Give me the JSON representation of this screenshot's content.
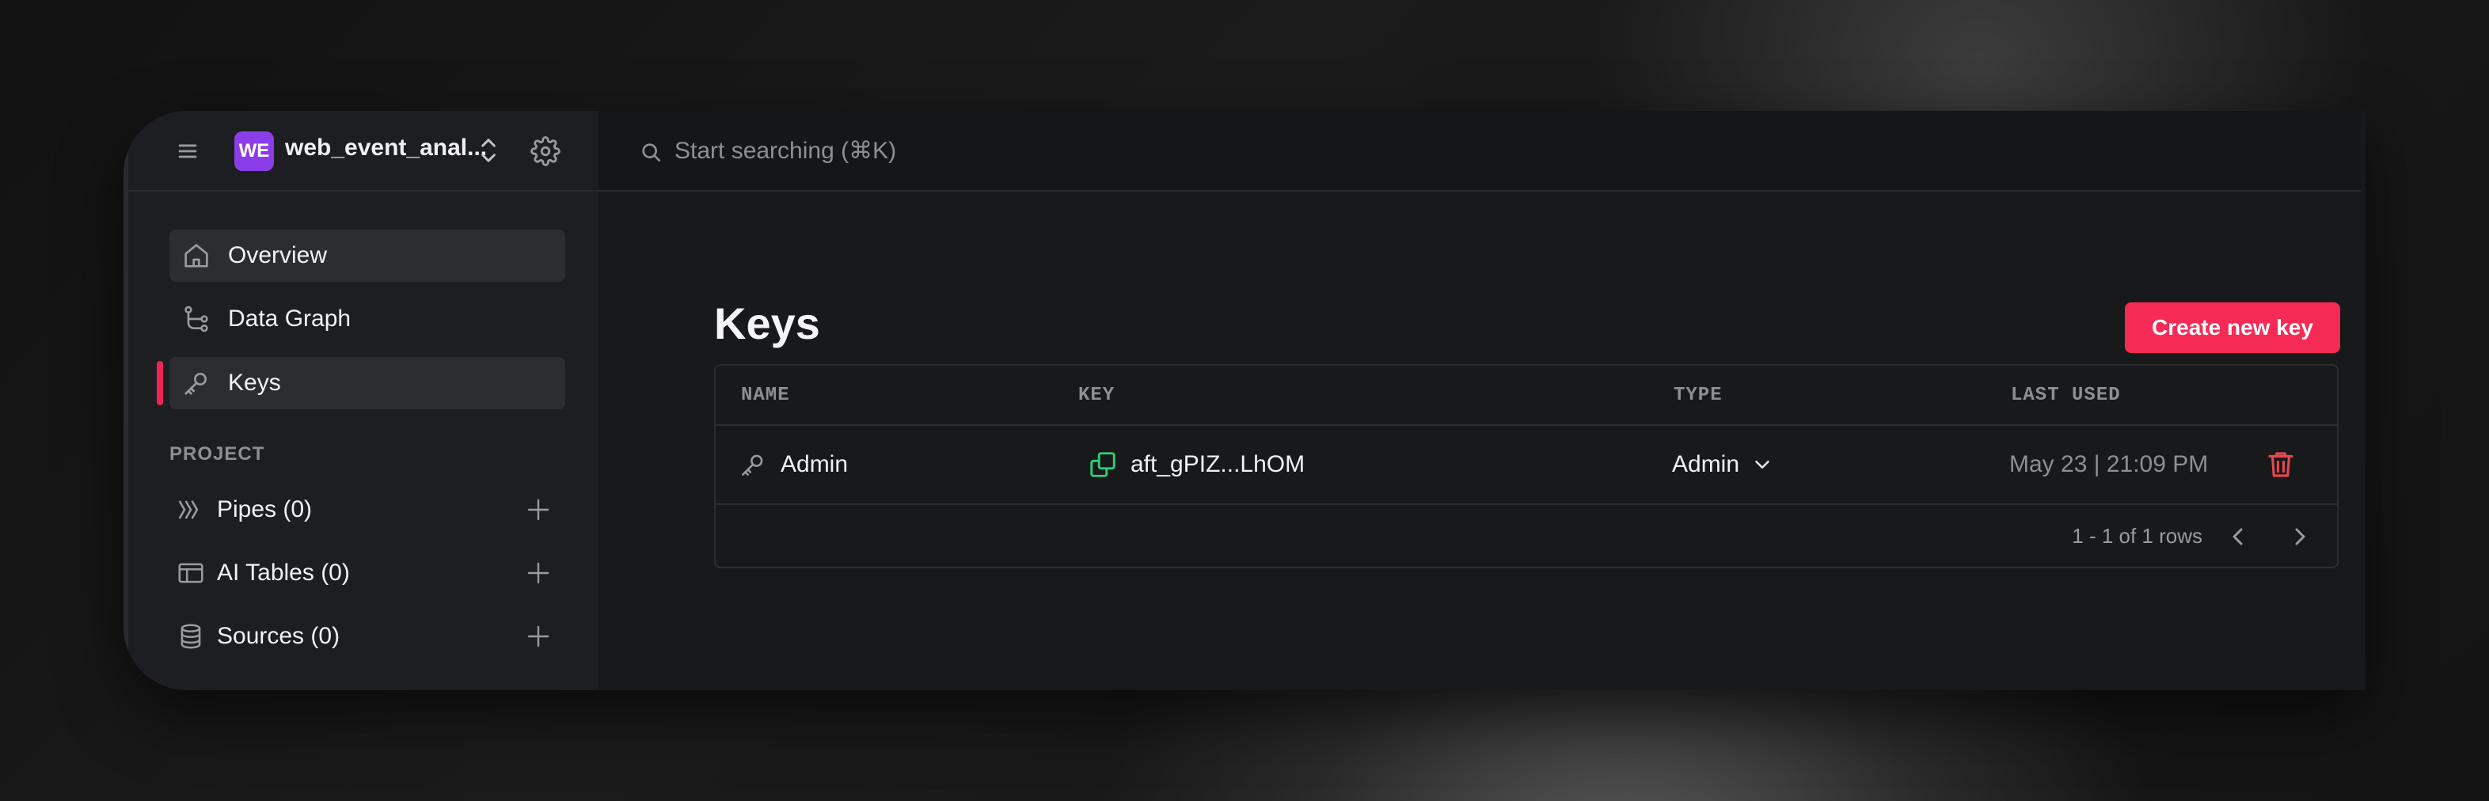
{
  "workspace": {
    "badge": "WE",
    "name": "web_event_anal..."
  },
  "search": {
    "placeholder": "Start searching (⌘K)"
  },
  "nav": {
    "items": [
      {
        "label": "Overview"
      },
      {
        "label": "Data Graph"
      },
      {
        "label": "Keys"
      }
    ]
  },
  "project": {
    "section_label": "PROJECT",
    "items": [
      {
        "label": "Pipes (0)"
      },
      {
        "label": "AI Tables (0)"
      },
      {
        "label": "Sources (0)"
      }
    ]
  },
  "page": {
    "title": "Keys",
    "create_label": "Create new key"
  },
  "table": {
    "columns": [
      "NAME",
      "KEY",
      "TYPE",
      "LAST USED"
    ],
    "rows": [
      {
        "name": "Admin",
        "key": "aft_gPIZ...LhOM",
        "type": "Admin",
        "last_used": "May 23 | 21:09 PM"
      }
    ],
    "pagination": "1 - 1 of 1 rows"
  },
  "colors": {
    "accent": "#f52a55",
    "workspace_badge": "#8b3ee8",
    "copy_icon": "#2fd07a",
    "delete_icon": "#e5484d"
  }
}
